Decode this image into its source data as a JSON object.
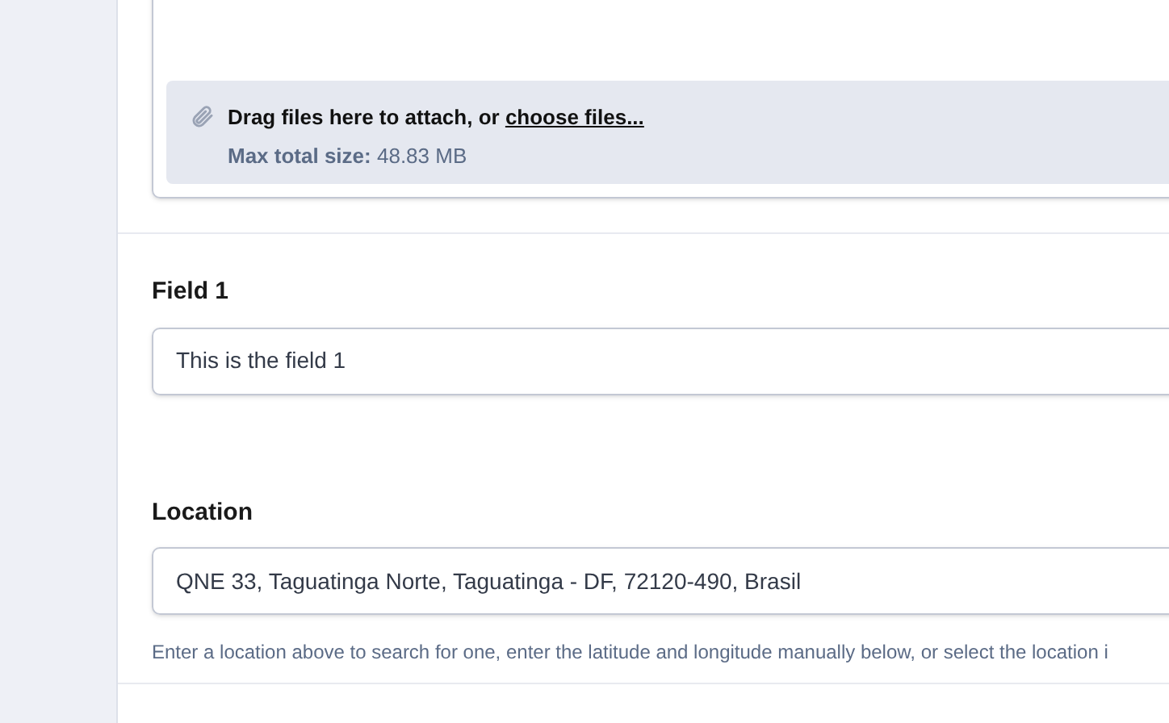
{
  "attachments": {
    "prompt": "Drag files here to attach, or ",
    "link": "choose files...",
    "size_label": "Max total size:",
    "size_value": "48.83 MB"
  },
  "fields": [
    {
      "label": "Field 1",
      "value": "This is the field 1"
    },
    {
      "label": "Location",
      "value": "QNE 33, Taguatinga Norte, Taguatinga - DF, 72120-490, Brasil",
      "help": "Enter a location above to search for one, enter the latitude and longitude manually below, or select the location i"
    }
  ]
}
